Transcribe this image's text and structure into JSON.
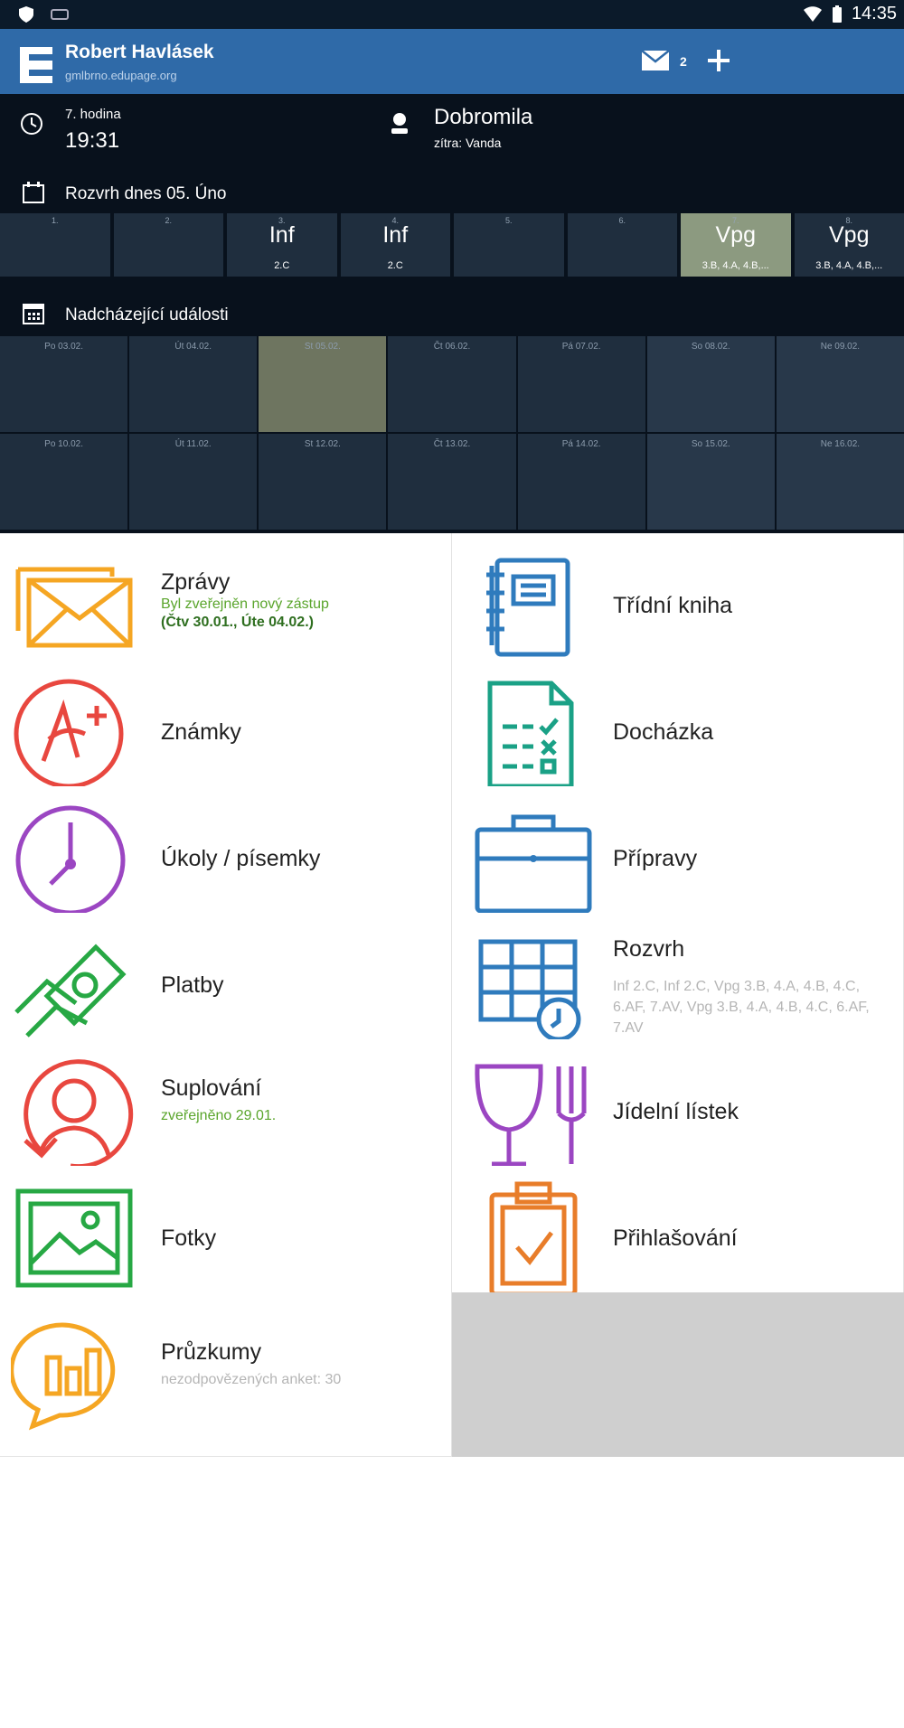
{
  "status_bar": {
    "time": "14:35"
  },
  "header": {
    "user_name": "Robert Havlásek",
    "domain": "gmlbrno.edupage.org",
    "mail_count": "2"
  },
  "dashboard": {
    "hour_label": "7. hodina",
    "hour_time": "19:31",
    "nameday_today": "Dobromila",
    "nameday_tomorrow": "zítra: Vanda",
    "schedule_title": "Rozvrh dnes 05. Úno",
    "schedule": [
      {
        "period": "1.",
        "subject": "",
        "class": ""
      },
      {
        "period": "2.",
        "subject": "",
        "class": ""
      },
      {
        "period": "3.",
        "subject": "Inf",
        "class": "2.C"
      },
      {
        "period": "4.",
        "subject": "Inf",
        "class": "2.C"
      },
      {
        "period": "5.",
        "subject": "",
        "class": ""
      },
      {
        "period": "6.",
        "subject": "",
        "class": ""
      },
      {
        "period": "7.",
        "subject": "Vpg",
        "class": "3.B, 4.A, 4.B,..."
      },
      {
        "period": "8.",
        "subject": "Vpg",
        "class": "3.B, 4.A, 4.B,..."
      }
    ],
    "current_period": "7.",
    "events_title": "Nadcházející události",
    "events_week1": [
      "Po 03.02.",
      "Út 04.02.",
      "St 05.02.",
      "Čt 06.02.",
      "Pá 07.02.",
      "So 08.02.",
      "Ne 09.02."
    ],
    "events_week2": [
      "Po 10.02.",
      "Út 11.02.",
      "St 12.02.",
      "Čt 13.02.",
      "Pá 14.02.",
      "So 15.02.",
      "Ne 16.02."
    ]
  },
  "menu": {
    "messages": {
      "label": "Zprávy",
      "sub1": "Byl zveřejněn nový zástup",
      "sub2": "(Čtv 30.01., Úte 04.02.)",
      "icon": "envelope-icon",
      "color": "#f5a623"
    },
    "class_book": {
      "label": "Třídní kniha",
      "icon": "notebook-icon",
      "color": "#2f7bbd"
    },
    "grades": {
      "label": "Známky",
      "icon": "grade-a-plus-icon",
      "color": "#e8473f"
    },
    "attendance": {
      "label": "Docházka",
      "icon": "attendance-checklist-icon",
      "color": "#1aa186"
    },
    "homework": {
      "label": "Úkoly / písemky",
      "icon": "clock-icon",
      "color": "#9b46c2"
    },
    "preparation": {
      "label": "Přípravy",
      "icon": "briefcase-icon",
      "color": "#2f7bbd"
    },
    "payments": {
      "label": "Platby",
      "icon": "hand-money-icon",
      "color": "#27a844"
    },
    "timetable": {
      "label": "Rozvrh",
      "desc": "Inf 2.C, Inf 2.C, Vpg 3.B, 4.A, 4.B, 4.C, 6.AF, 7.AV, Vpg 3.B, 4.A, 4.B, 4.C, 6.AF, 7.AV",
      "icon": "timetable-icon",
      "color": "#2f7bbd"
    },
    "substitution": {
      "label": "Suplování",
      "sub": "zveřejněno 29.01.",
      "icon": "person-icon",
      "color": "#e8473f"
    },
    "menu_food": {
      "label": "Jídelní lístek",
      "icon": "glass-fork-icon",
      "color": "#9b46c2"
    },
    "photos": {
      "label": "Fotky",
      "icon": "picture-icon",
      "color": "#27a844"
    },
    "enrollment": {
      "label": "Přihlašování",
      "icon": "clipboard-check-icon",
      "color": "#e87d2a"
    },
    "surveys": {
      "label": "Průzkumy",
      "sub": "nezodpovězených anket: 30",
      "icon": "survey-chart-icon",
      "color": "#f5a623"
    }
  }
}
